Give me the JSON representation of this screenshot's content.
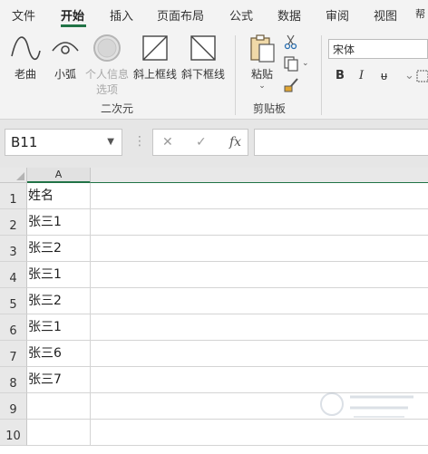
{
  "ribbon_tabs": [
    "文件",
    "开始",
    "插入",
    "页面布局",
    "公式",
    "数据",
    "审阅",
    "视图",
    "帮"
  ],
  "shapes_group": {
    "buttons": [
      "老曲",
      "小弧",
      "个人信息选项",
      "斜上框线",
      "斜下框线"
    ],
    "disabled_button_line1": "个人信息",
    "disabled_button_line2": "选项",
    "label": "二次元"
  },
  "clipboard_group": {
    "paste_label": "粘贴",
    "label": "剪贴板"
  },
  "font": {
    "name": "宋体",
    "bold": "B",
    "italic": "I",
    "strike": "ᵾ"
  },
  "formula_bar": {
    "cell_ref": "B11",
    "cancel": "✕",
    "enter": "✓",
    "fx": "fx",
    "value": ""
  },
  "sheet": {
    "column_headers": [
      "A"
    ],
    "rows": [
      {
        "num": "1",
        "a": "姓名"
      },
      {
        "num": "2",
        "a": "张三1"
      },
      {
        "num": "3",
        "a": "张三2"
      },
      {
        "num": "4",
        "a": "张三1"
      },
      {
        "num": "5",
        "a": "张三2"
      },
      {
        "num": "6",
        "a": "张三1"
      },
      {
        "num": "7",
        "a": "张三6"
      },
      {
        "num": "8",
        "a": "张三7"
      },
      {
        "num": "9",
        "a": ""
      },
      {
        "num": "10",
        "a": ""
      }
    ]
  },
  "colors": {
    "accent": "#217346",
    "ribbon_bg": "#f3f3f3"
  }
}
